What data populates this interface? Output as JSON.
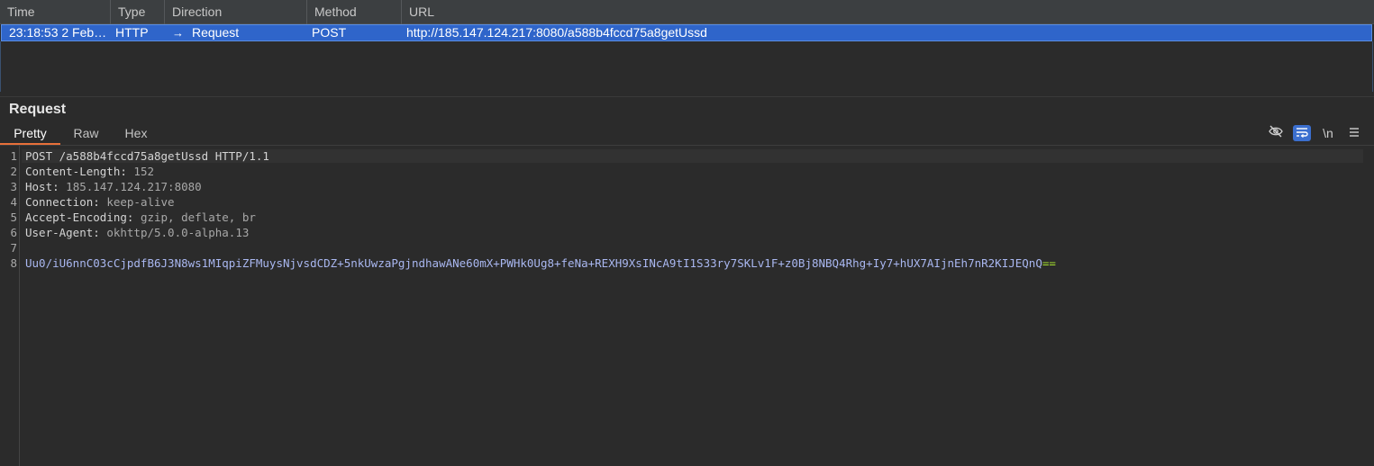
{
  "table": {
    "columns": [
      "Time",
      "Type",
      "Direction",
      "Method",
      "URL"
    ],
    "row": {
      "time": "23:18:53 2 Feb…",
      "type": "HTTP",
      "direction_arrow": "→",
      "direction": "Request",
      "method": "POST",
      "url": "http://185.147.124.217:8080/a588b4fccd75a8getUssd"
    }
  },
  "panel": {
    "title": "Request",
    "tabs": [
      "Pretty",
      "Raw",
      "Hex"
    ],
    "active_tab": "Pretty",
    "toolbar": {
      "hide_icon": "eye-off-icon",
      "wrap_icon": "wrap-lines-icon",
      "newline_label": "\\n",
      "menu_icon": "hamburger-menu-icon"
    }
  },
  "editor": {
    "line_numbers": [
      "1",
      "2",
      "3",
      "4",
      "5",
      "6",
      "7",
      "8"
    ],
    "request_line": "POST /a588b4fccd75a8getUssd HTTP/1.1",
    "headers": [
      {
        "name": "Content-Length:",
        "value": "152"
      },
      {
        "name": "Host:",
        "value": "185.147.124.217:8080"
      },
      {
        "name": "Connection:",
        "value": "keep-alive"
      },
      {
        "name": "Accept-Encoding:",
        "value": "gzip, deflate, br"
      },
      {
        "name": "User-Agent:",
        "value": "okhttp/5.0.0-alpha.13"
      }
    ],
    "body": "Uu0/iU6nnC03cCjpdfB6J3N8ws1MIqpiZFMuysNjvsdCDZ+5nkUwzaPgjndhawANe60mX+PWHk0Ug8+feNa+REXH9XsINcA9tI1S33ry7SKLv1F+z0Bj8NBQ4Rhg+Iy7+hUX7AIjnEh7nR2KIJEQnQ",
    "body_padding": "=="
  },
  "colors": {
    "selection": "#2f65ca",
    "active_tab_underline": "#e8703a",
    "body_text": "#a9b7f0",
    "padding_text": "#a6e22e"
  }
}
